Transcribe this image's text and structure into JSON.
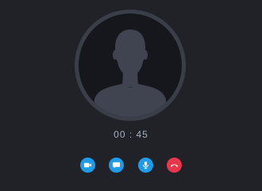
{
  "call": {
    "timer": "00 : 45"
  },
  "controls": {
    "buttons": [
      {
        "icon": "video-camera-icon",
        "color": "#1e9be9"
      },
      {
        "icon": "chat-bubble-icon",
        "color": "#1e9be9"
      },
      {
        "icon": "microphone-icon",
        "color": "#1e9be9"
      },
      {
        "icon": "end-call-icon",
        "color": "#e8374a"
      }
    ]
  },
  "colors": {
    "background": "#202228",
    "avatar_ring": "#3a3e48",
    "avatar_bg": "#15171c",
    "avatar_silhouette": "#3f4450",
    "timer_text": "#a6aebb",
    "accent_blue": "#1e9be9",
    "end_call_red": "#e8374a"
  }
}
